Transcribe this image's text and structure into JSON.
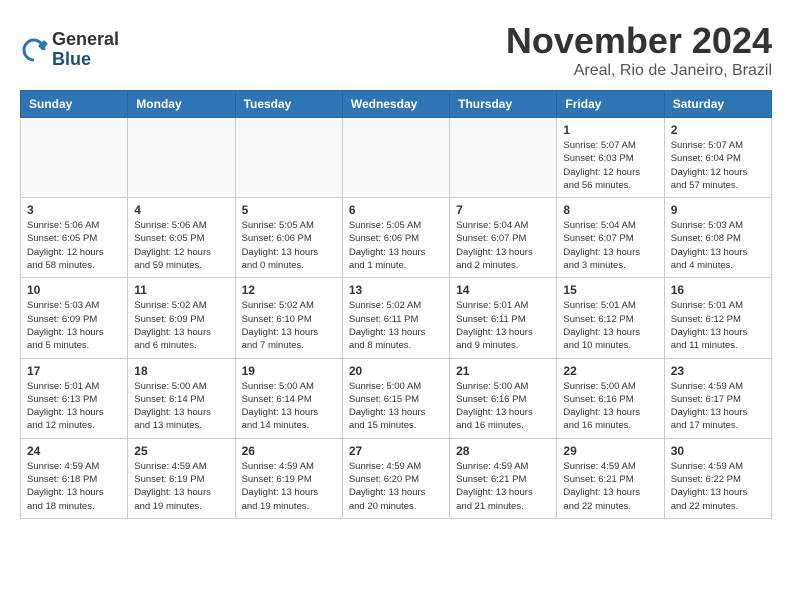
{
  "logo": {
    "general": "General",
    "blue": "Blue"
  },
  "title": "November 2024",
  "location": "Areal, Rio de Janeiro, Brazil",
  "days_of_week": [
    "Sunday",
    "Monday",
    "Tuesday",
    "Wednesday",
    "Thursday",
    "Friday",
    "Saturday"
  ],
  "weeks": [
    {
      "days": [
        {
          "num": "",
          "info": ""
        },
        {
          "num": "",
          "info": ""
        },
        {
          "num": "",
          "info": ""
        },
        {
          "num": "",
          "info": ""
        },
        {
          "num": "",
          "info": ""
        },
        {
          "num": "1",
          "info": "Sunrise: 5:07 AM\nSunset: 6:03 PM\nDaylight: 12 hours and 56 minutes."
        },
        {
          "num": "2",
          "info": "Sunrise: 5:07 AM\nSunset: 6:04 PM\nDaylight: 12 hours and 57 minutes."
        }
      ]
    },
    {
      "days": [
        {
          "num": "3",
          "info": "Sunrise: 5:06 AM\nSunset: 6:05 PM\nDaylight: 12 hours and 58 minutes."
        },
        {
          "num": "4",
          "info": "Sunrise: 5:06 AM\nSunset: 6:05 PM\nDaylight: 12 hours and 59 minutes."
        },
        {
          "num": "5",
          "info": "Sunrise: 5:05 AM\nSunset: 6:06 PM\nDaylight: 13 hours and 0 minutes."
        },
        {
          "num": "6",
          "info": "Sunrise: 5:05 AM\nSunset: 6:06 PM\nDaylight: 13 hours and 1 minute."
        },
        {
          "num": "7",
          "info": "Sunrise: 5:04 AM\nSunset: 6:07 PM\nDaylight: 13 hours and 2 minutes."
        },
        {
          "num": "8",
          "info": "Sunrise: 5:04 AM\nSunset: 6:07 PM\nDaylight: 13 hours and 3 minutes."
        },
        {
          "num": "9",
          "info": "Sunrise: 5:03 AM\nSunset: 6:08 PM\nDaylight: 13 hours and 4 minutes."
        }
      ]
    },
    {
      "days": [
        {
          "num": "10",
          "info": "Sunrise: 5:03 AM\nSunset: 6:09 PM\nDaylight: 13 hours and 5 minutes."
        },
        {
          "num": "11",
          "info": "Sunrise: 5:02 AM\nSunset: 6:09 PM\nDaylight: 13 hours and 6 minutes."
        },
        {
          "num": "12",
          "info": "Sunrise: 5:02 AM\nSunset: 6:10 PM\nDaylight: 13 hours and 7 minutes."
        },
        {
          "num": "13",
          "info": "Sunrise: 5:02 AM\nSunset: 6:11 PM\nDaylight: 13 hours and 8 minutes."
        },
        {
          "num": "14",
          "info": "Sunrise: 5:01 AM\nSunset: 6:11 PM\nDaylight: 13 hours and 9 minutes."
        },
        {
          "num": "15",
          "info": "Sunrise: 5:01 AM\nSunset: 6:12 PM\nDaylight: 13 hours and 10 minutes."
        },
        {
          "num": "16",
          "info": "Sunrise: 5:01 AM\nSunset: 6:12 PM\nDaylight: 13 hours and 11 minutes."
        }
      ]
    },
    {
      "days": [
        {
          "num": "17",
          "info": "Sunrise: 5:01 AM\nSunset: 6:13 PM\nDaylight: 13 hours and 12 minutes."
        },
        {
          "num": "18",
          "info": "Sunrise: 5:00 AM\nSunset: 6:14 PM\nDaylight: 13 hours and 13 minutes."
        },
        {
          "num": "19",
          "info": "Sunrise: 5:00 AM\nSunset: 6:14 PM\nDaylight: 13 hours and 14 minutes."
        },
        {
          "num": "20",
          "info": "Sunrise: 5:00 AM\nSunset: 6:15 PM\nDaylight: 13 hours and 15 minutes."
        },
        {
          "num": "21",
          "info": "Sunrise: 5:00 AM\nSunset: 6:16 PM\nDaylight: 13 hours and 16 minutes."
        },
        {
          "num": "22",
          "info": "Sunrise: 5:00 AM\nSunset: 6:16 PM\nDaylight: 13 hours and 16 minutes."
        },
        {
          "num": "23",
          "info": "Sunrise: 4:59 AM\nSunset: 6:17 PM\nDaylight: 13 hours and 17 minutes."
        }
      ]
    },
    {
      "days": [
        {
          "num": "24",
          "info": "Sunrise: 4:59 AM\nSunset: 6:18 PM\nDaylight: 13 hours and 18 minutes."
        },
        {
          "num": "25",
          "info": "Sunrise: 4:59 AM\nSunset: 6:19 PM\nDaylight: 13 hours and 19 minutes."
        },
        {
          "num": "26",
          "info": "Sunrise: 4:59 AM\nSunset: 6:19 PM\nDaylight: 13 hours and 19 minutes."
        },
        {
          "num": "27",
          "info": "Sunrise: 4:59 AM\nSunset: 6:20 PM\nDaylight: 13 hours and 20 minutes."
        },
        {
          "num": "28",
          "info": "Sunrise: 4:59 AM\nSunset: 6:21 PM\nDaylight: 13 hours and 21 minutes."
        },
        {
          "num": "29",
          "info": "Sunrise: 4:59 AM\nSunset: 6:21 PM\nDaylight: 13 hours and 22 minutes."
        },
        {
          "num": "30",
          "info": "Sunrise: 4:59 AM\nSunset: 6:22 PM\nDaylight: 13 hours and 22 minutes."
        }
      ]
    }
  ]
}
